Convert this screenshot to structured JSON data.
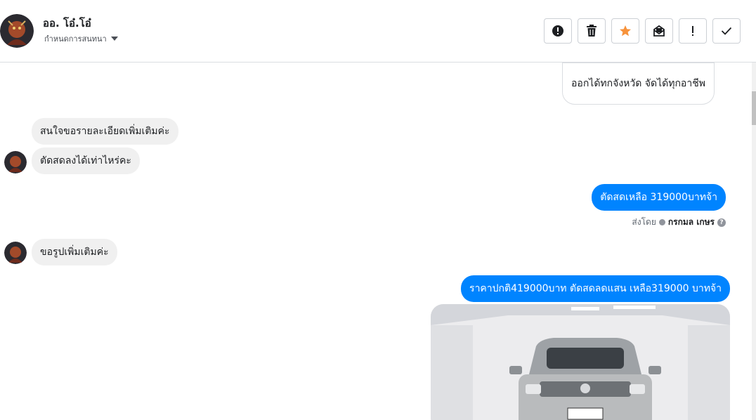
{
  "header": {
    "contact_name": "ออ. โอ๋.โอ๋",
    "subtitle": "กำหนดการสนทนา",
    "toolbar": [
      {
        "name": "report-spam-button",
        "icon": "alert-circle-icon"
      },
      {
        "name": "delete-button",
        "icon": "trash-icon"
      },
      {
        "name": "star-button",
        "icon": "star-icon",
        "color": "#f7923b"
      },
      {
        "name": "mark-unread-button",
        "icon": "envelope-open-icon"
      },
      {
        "name": "follow-up-button",
        "icon": "exclamation-icon"
      },
      {
        "name": "done-button",
        "icon": "check-icon"
      }
    ]
  },
  "messages": {
    "m0": "ออกได้ทกจังหวัด จัดได้ทุกอาชีพ",
    "m1": "สนใจขอรายละเอียดเพิ่มเติมค่ะ",
    "m2": "ตัดสดลงได้เท่าไหร่คะ",
    "m3": "ตัดสดเหลือ 319000บาทจ้า",
    "sent_by_label": "ส่งโดย",
    "sent_by_name": "กรกมล เกษร",
    "m4": "ขอรูปเพิ่มเติมค่ะ",
    "m5": "ราคาปกติ419000บาท ตัดสดลดแสน เหลือ319000 บาทจ้า"
  },
  "colors": {
    "accent_blue": "#0084ff",
    "incoming_bubble": "#f0f0f0"
  }
}
